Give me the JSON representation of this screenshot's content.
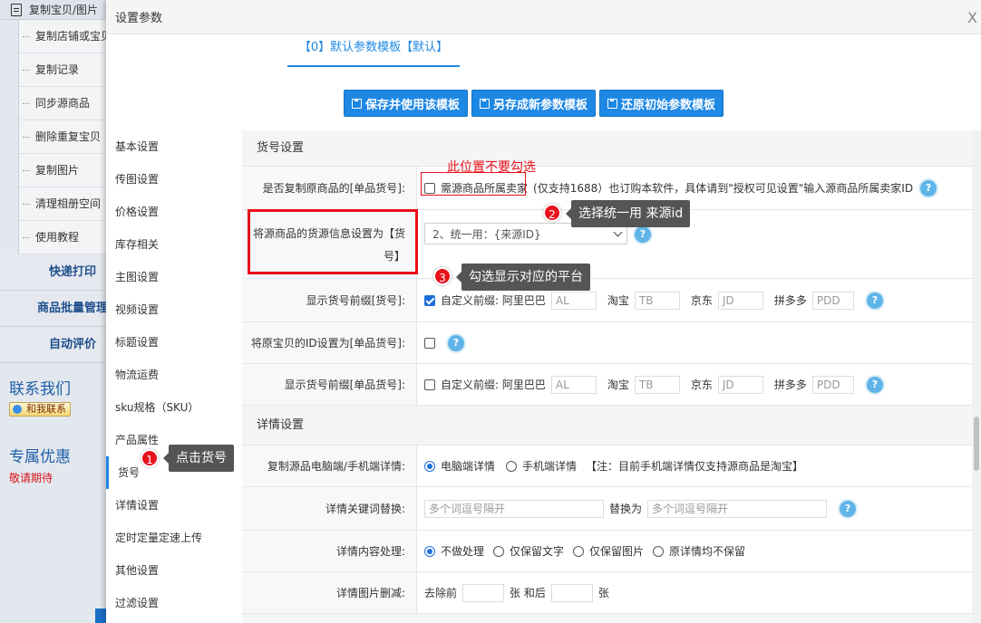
{
  "app": {
    "top_menu_label": "复制宝贝/图片",
    "sub_items": [
      "复制店铺或宝贝",
      "复制记录",
      "同步源商品",
      "删除重复宝贝",
      "复制图片",
      "清理相册空间",
      "使用教程"
    ],
    "menu_heads": [
      "快递打印",
      "商品批量管理",
      "自动评价"
    ],
    "contact_title": "联系我们",
    "contact_button": "和我联系",
    "promo_title": "专属优惠",
    "promo_text": "敬请期待"
  },
  "modal": {
    "title": "设置参数",
    "close": "X",
    "template_tab": "【0】默认参数模板【默认】",
    "buttons": [
      "保存并使用该模板",
      "另存成新参数模板",
      "还原初始参数模板"
    ]
  },
  "nav": {
    "items": [
      "基本设置",
      "传图设置",
      "价格设置",
      "库存相关",
      "主图设置",
      "视频设置",
      "标题设置",
      "物流运费",
      "sku规格（SKU）",
      "产品属性",
      "货号",
      "详情设置",
      "定时定量定速上传",
      "其他设置",
      "过滤设置"
    ],
    "active": "货号"
  },
  "huohao": {
    "section_title": "货号设置",
    "row1": {
      "label": "是否复制原商品的[单品货号]:",
      "checkbox_label": "需源商品所属卖家",
      "note": "(仅支持1688）也订购本软件，具体请到\"授权可见设置\"输入源商品所属卖家ID"
    },
    "row2": {
      "label_line1": "将源商品的货源信息设置为【货",
      "label_line2": "号】",
      "select_value": "2、统一用：{来源ID}"
    },
    "row3": {
      "label": "显示货号前缀[货号]:",
      "checked": true,
      "prefix_label": "自定义前缀: 阿里巴巴",
      "platforms": [
        {
          "name": "阿里巴巴",
          "value": "AL"
        },
        {
          "name": "淘宝",
          "value": "TB"
        },
        {
          "name": "京东",
          "value": "JD"
        },
        {
          "name": "拼多多",
          "value": "PDD"
        }
      ]
    },
    "row4": {
      "label": "将原宝贝的ID设置为[单品货号]:",
      "checked": false
    },
    "row5": {
      "label": "显示货号前缀[单品货号]:",
      "checked": false,
      "prefix_label": "自定义前缀: 阿里巴巴",
      "platforms": [
        {
          "name": "阿里巴巴",
          "value": "AL"
        },
        {
          "name": "淘宝",
          "value": "TB"
        },
        {
          "name": "京东",
          "value": "JD"
        },
        {
          "name": "拼多多",
          "value": "PDD"
        }
      ]
    }
  },
  "detail": {
    "section_title": "详情设置",
    "row1": {
      "label": "复制源品电脑端/手机端详情:",
      "options": [
        "电脑端详情",
        "手机端详情"
      ],
      "selected": "电脑端详情",
      "note": "【注：目前手机端详情仅支持源商品是淘宝】"
    },
    "row2": {
      "label": "详情关键词替换:",
      "placeholder1": "多个词逗号隔开",
      "replace_label": "替换为",
      "placeholder2": "多个词逗号隔开"
    },
    "row3": {
      "label": "详情内容处理:",
      "options": [
        "不做处理",
        "仅保留文字",
        "仅保留图片",
        "原详情均不保留"
      ],
      "selected": "不做处理"
    },
    "row4": {
      "label": "详情图片删减:",
      "prefix": "去除前",
      "mid": "张 和后",
      "suffix": "张"
    }
  },
  "annotations": {
    "note_top": "此位置不要勾选",
    "step1": {
      "num": "1",
      "text": "点击货号"
    },
    "step2": {
      "num": "2",
      "text": "选择统一用 来源id"
    },
    "step3": {
      "num": "3",
      "text": "勾选显示对应的平台"
    }
  },
  "colors": {
    "accent": "#1e88e5",
    "annotation_red": "#e8101a",
    "tooltip_bg": "#555555"
  }
}
